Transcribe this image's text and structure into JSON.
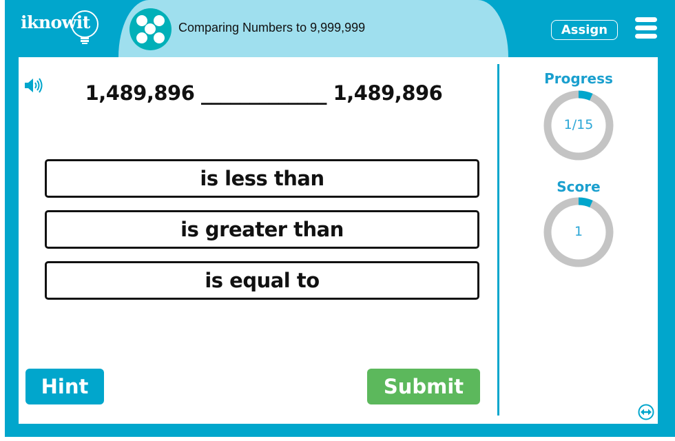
{
  "header": {
    "logo_text": "iknowit",
    "lesson_title": "Comparing Numbers to 9,999,999",
    "lesson_icon": "five-dots-icon",
    "assign_label": "Assign",
    "menu_icon": "hamburger-menu-icon"
  },
  "question": {
    "audio_icon": "speaker-icon",
    "text": "1,489,896 _____________ 1,489,896"
  },
  "choices": [
    {
      "label": "is less than"
    },
    {
      "label": "is greater than"
    },
    {
      "label": "is equal to"
    }
  ],
  "actions": {
    "hint_label": "Hint",
    "submit_label": "Submit"
  },
  "sidebar": {
    "progress": {
      "label": "Progress",
      "value_text": "1/15",
      "current": 1,
      "total": 15
    },
    "score": {
      "label": "Score",
      "value_text": "1",
      "fraction": 0.067
    },
    "expand_icon": "expand-horizontal-icon"
  },
  "colors": {
    "brand_blue": "#01a6cc",
    "banner_light": "#9fdfee",
    "icon_teal": "#01b0b8",
    "submit_green": "#5cb85c",
    "ring_gray": "#c4c4c4",
    "ring_fill": "#01a6cc"
  }
}
